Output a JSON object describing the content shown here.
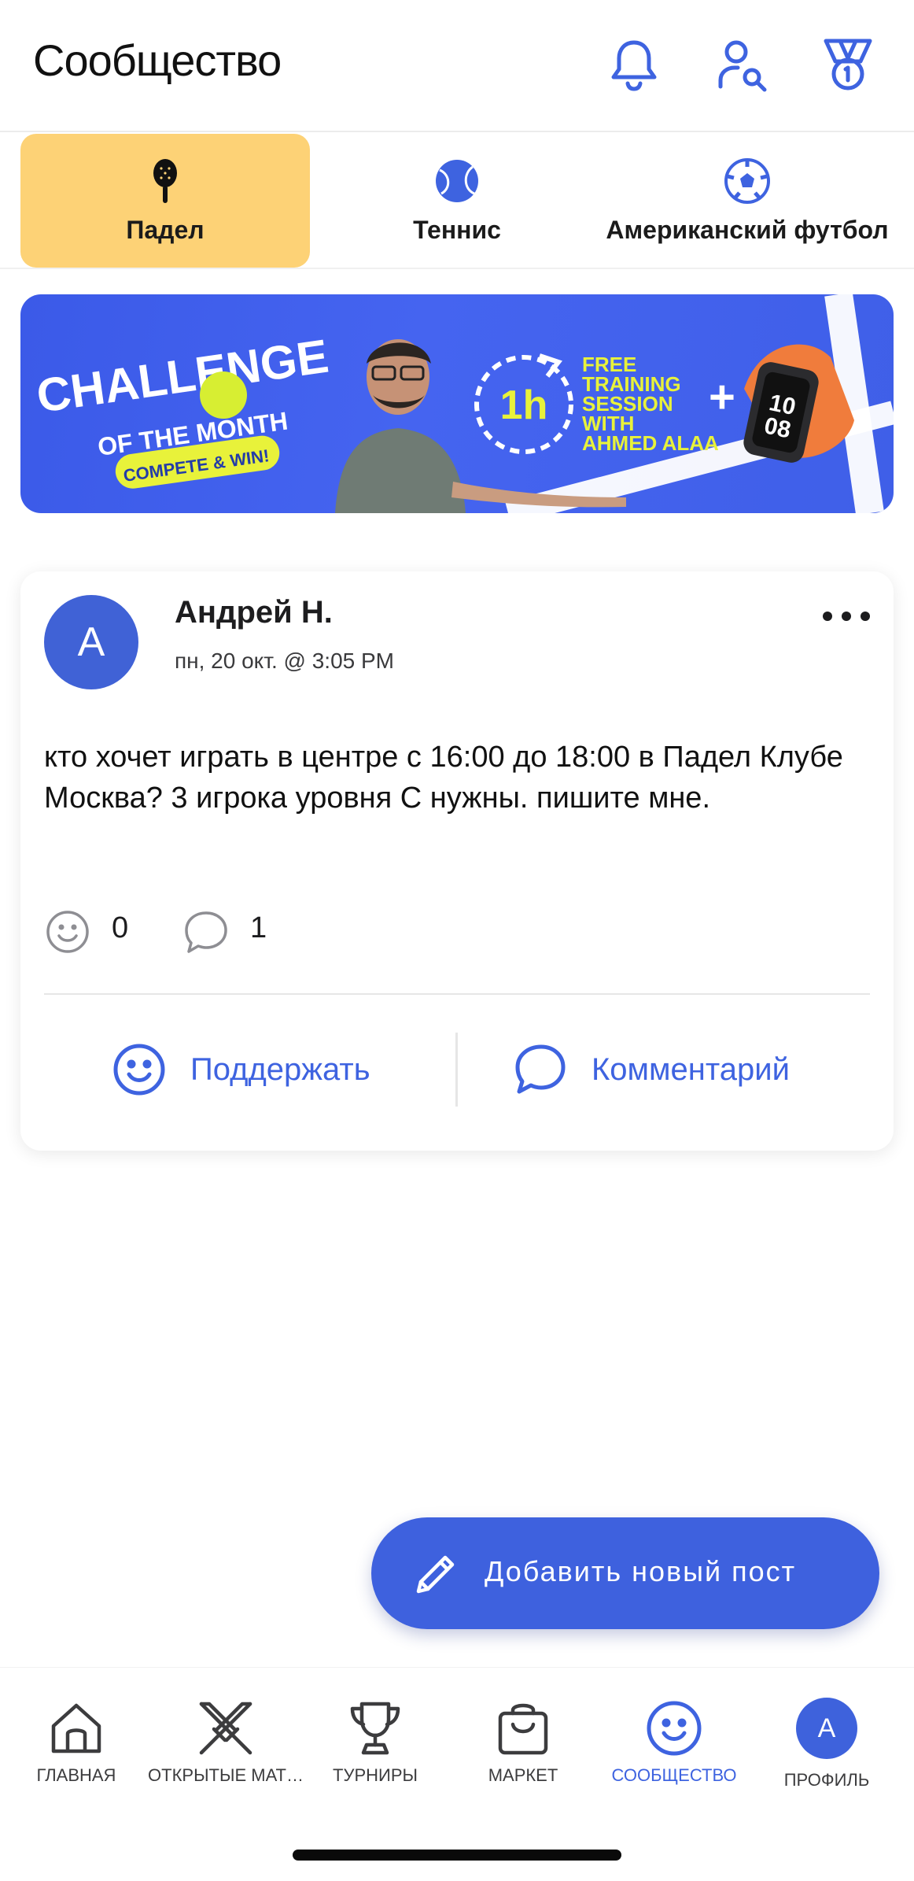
{
  "header": {
    "title": "Сообщество"
  },
  "tabs": [
    {
      "label": "Падел",
      "active": true
    },
    {
      "label": "Теннис",
      "active": false
    },
    {
      "label": "Американский футбол",
      "active": false
    }
  ],
  "banner": {
    "line1": "CHALLENGE",
    "line2": "OF THE MONTH",
    "line3": "COMPETE & WIN!",
    "duration": "1h",
    "offer_lines": [
      "FREE",
      "TRAINING",
      "SESSION",
      "WITH",
      "AHMED ALAA"
    ],
    "plus": "+",
    "watch_time_top": "10",
    "watch_time_bottom": "08"
  },
  "post": {
    "avatar_letter": "A",
    "author": "Андрей Н.",
    "time": "пн, 20 окт. @ 3:05 PM",
    "text": "кто хочет играть в центре с 16:00 до 18:00 в Падел Клубе Москва? 3 игрока уровня C нужны. пишите мне.",
    "reactions_count": "0",
    "comments_count": "1",
    "support_label": "Поддержать",
    "comment_label": "Комментарий"
  },
  "fab": {
    "label": "Добавить новый пост"
  },
  "bottom_nav": {
    "items": [
      {
        "label": "ГЛАВНАЯ",
        "icon": "home-icon"
      },
      {
        "label": "ОТКРЫТЫЕ МАТ…",
        "icon": "crossed-swords-icon"
      },
      {
        "label": "ТУРНИРЫ",
        "icon": "trophy-icon"
      },
      {
        "label": "МАРКЕТ",
        "icon": "shopping-bag-icon"
      },
      {
        "label": "СООБЩЕСТВО",
        "icon": "smiley-icon",
        "active": true
      },
      {
        "label": "ПРОФИЛЬ",
        "icon": "avatar",
        "avatar_letter": "A"
      }
    ]
  },
  "colors": {
    "accent": "#3e63e0",
    "tab_active": "#fdd276",
    "banner_bg": "#4564f0",
    "banner_yellow": "#e8f23a"
  }
}
